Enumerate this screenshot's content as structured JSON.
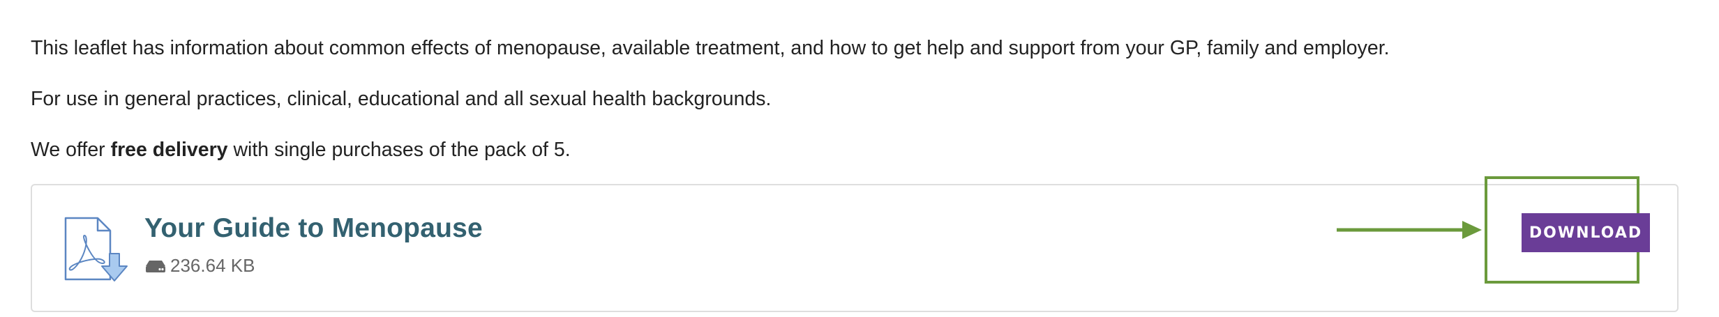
{
  "intro": {
    "line1": "This leaflet has information about common effects of menopause, available treatment, and how to get help and support from your GP, family and employer.",
    "line2": "For use in general practices, clinical, educational and all sexual health backgrounds.",
    "line3_before": "We offer ",
    "line3_bold": "free delivery",
    "line3_after": " with single purchases of the pack of 5."
  },
  "resource": {
    "title": "Your Guide to Menopause",
    "file_size": "236.64 KB",
    "file_icon": "pdf-download-icon",
    "size_icon": "hard-drive-icon",
    "download_label": "DOWNLOAD"
  },
  "annotation": {
    "color": "#6b9a3c",
    "arrow_icon": "arrow-right-icon"
  },
  "colors": {
    "title": "#336170",
    "button": "#6a3d97",
    "icon": "#5b86c2"
  }
}
